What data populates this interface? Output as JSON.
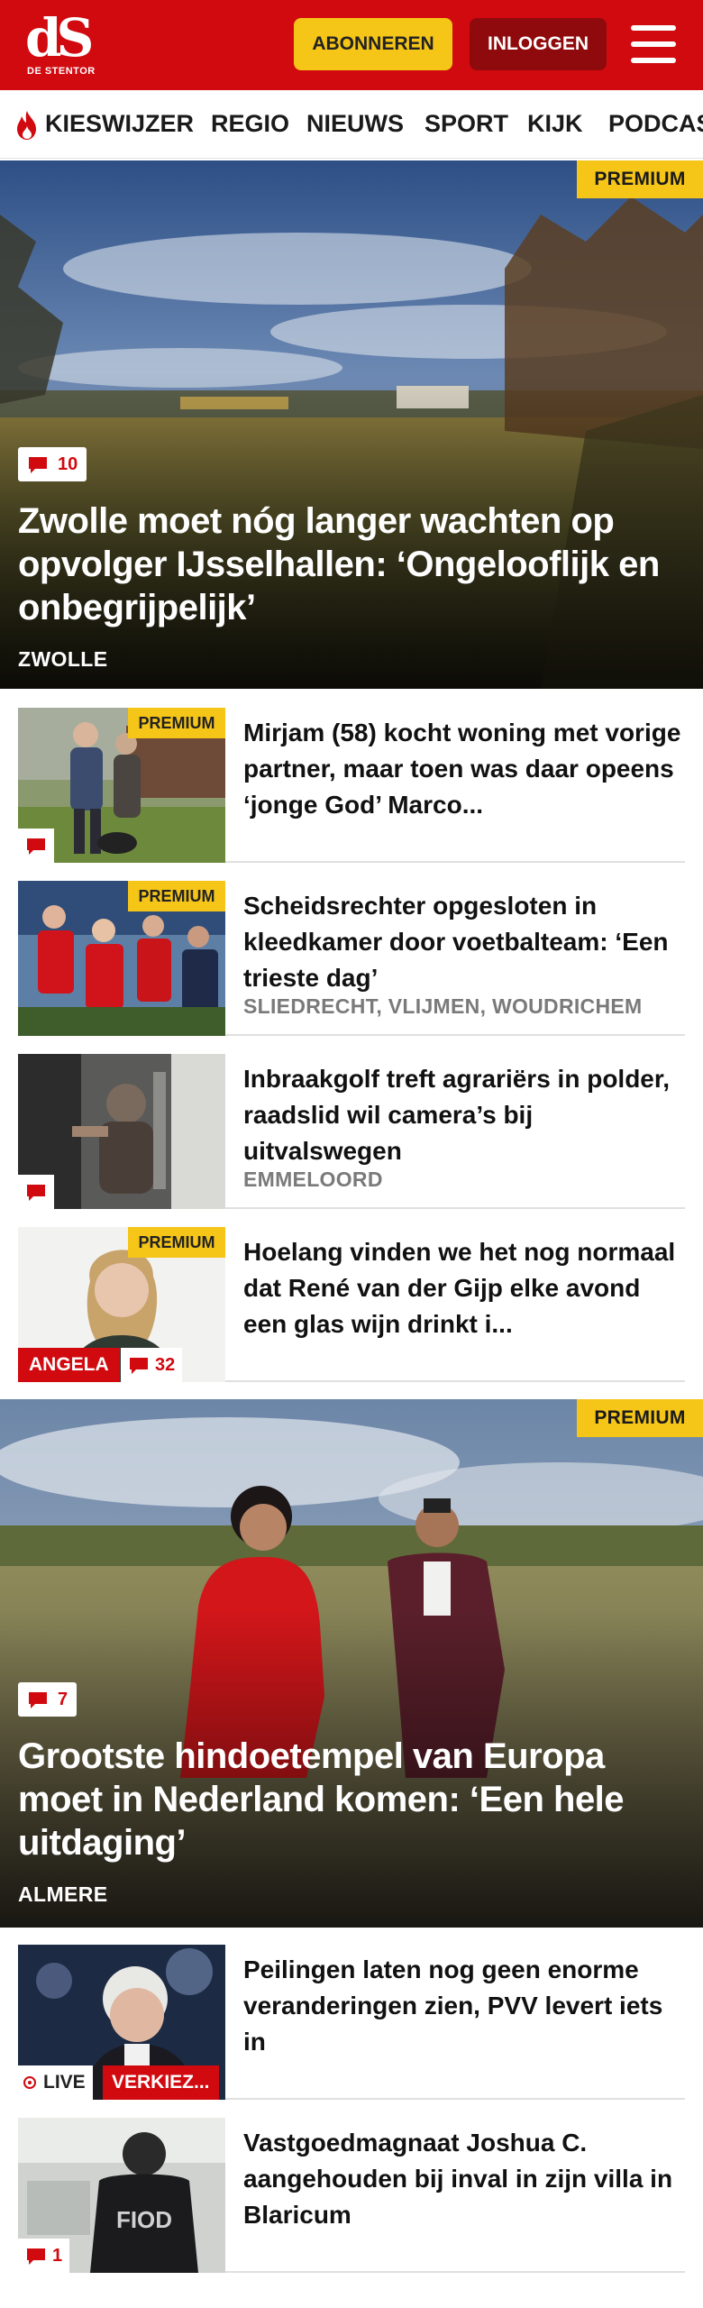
{
  "header": {
    "logo_text": "dS",
    "logo_subtitle": "DE STENTOR",
    "subscribe_label": "ABONNEREN",
    "login_label": "INLOGGEN",
    "menu_icon": "hamburger-menu-icon"
  },
  "nav": {
    "items": [
      {
        "label": "KIESWIJZER",
        "icon": "flame-icon"
      },
      {
        "label": "REGIO"
      },
      {
        "label": "NIEUWS"
      },
      {
        "label": "SPORT"
      },
      {
        "label": "KIJK"
      },
      {
        "label": "PODCAS"
      }
    ]
  },
  "colors": {
    "brand_red": "#d10a10",
    "premium_yellow": "#f5c518",
    "login_dark_red": "#8f0a0d",
    "location_grey": "#7a7a7a"
  },
  "hero1": {
    "premium_label": "PREMIUM",
    "comment_count": "10",
    "title": "Zwolle moet nóg langer wachten op opvolger IJsselhallen: ‘Ongelooflijk en onbegrijpelijk’",
    "location": "ZWOLLE"
  },
  "list1": [
    {
      "title": "Mirjam (58) kocht woning met vorige partner, maar toen was daar opeens ‘jonge God’ Marco...",
      "premium_label": "PREMIUM",
      "comment_icon": "comment-icon"
    },
    {
      "title": "Scheidsrechter opgesloten in kleedkamer door voetbalteam: ‘Een trieste dag’",
      "premium_label": "PREMIUM",
      "location": "SLIEDRECHT, VLIJMEN, WOUDRICHEM"
    },
    {
      "title": "Inbraakgolf treft agrariërs in polder, raadslid wil camera’s bij uitvalswegen",
      "location": "EMMELOORD",
      "comment_icon": "comment-icon"
    },
    {
      "title": "Hoelang vinden we het nog normaal dat René van der Gijp elke avond een glas wijn drinkt i...",
      "premium_label": "PREMIUM",
      "author_label": "ANGELA",
      "comment_count": "32"
    }
  ],
  "hero2": {
    "premium_label": "PREMIUM",
    "comment_count": "7",
    "title": "Grootste hindoetempel van Europa moet in Nederland komen: ‘Een hele uitdaging’",
    "location": "ALMERE"
  },
  "list2": [
    {
      "title": "Peilingen laten nog geen enorme veranderingen zien, PVV levert iets in",
      "live_label": "LIVE",
      "section_label": "VERKIEZ..."
    },
    {
      "title": "Vastgoedmagnaat Joshua C. aangehouden bij inval in zijn villa in Blaricum",
      "comment_count": "1",
      "image_text": "FIOD"
    }
  ]
}
